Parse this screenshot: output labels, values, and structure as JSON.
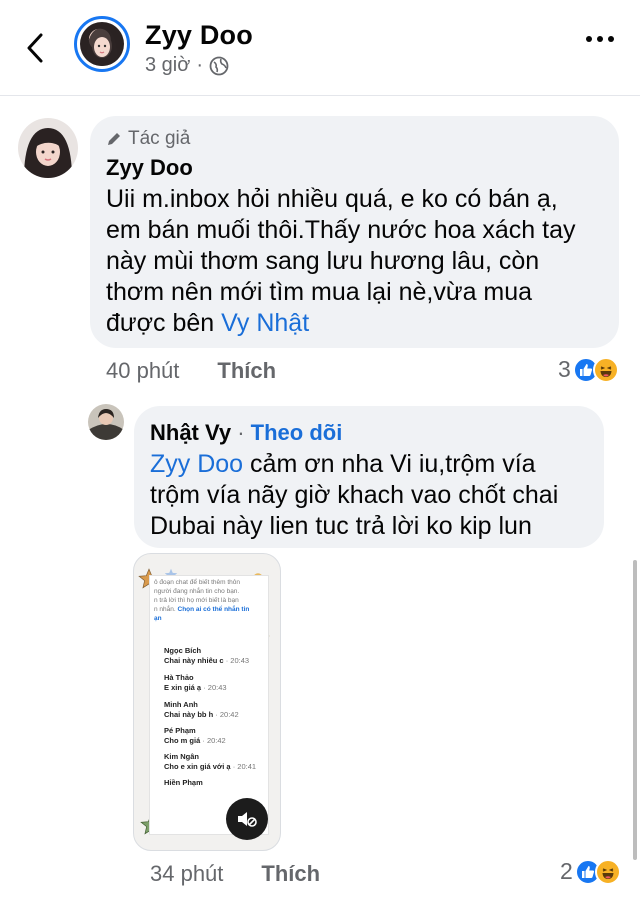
{
  "header": {
    "title": "Zyy Doo",
    "time": "3 giờ",
    "separator": "·"
  },
  "comment1": {
    "author_tag": "Tác giả",
    "name": "Zyy Doo",
    "text_lines": [
      "Uii m.inbox hỏi nhiều quá, e ko có bán ạ,",
      "em bán muối thôi.Thấy nước hoa xách tay",
      "này mùi thơm sang lưu hương lâu, còn",
      "thơm nên mới tìm mua lại nè,vừa mua"
    ],
    "last_line_prefix": "được bên ",
    "mention": "Vy Nhật",
    "time": "40 phút",
    "like_label": "Thích",
    "reaction_count": "3"
  },
  "reply1": {
    "name": "Nhật Vy",
    "separator": "·",
    "follow_label": "Theo dõi",
    "mention": "Zyy Doo",
    "text_first": " cảm ơn nha Vi iu,trộm vía",
    "text_lines": [
      "trộm vía nãy giờ khach vao chốt chai",
      "Dubai này lien tuc trả lời ko kip lun"
    ],
    "time": "34 phút",
    "like_label": "Thích",
    "reaction_count": "2"
  },
  "attachment": {
    "header_lines": [
      "ô đoạn chat để biết thêm thôn",
      "người đang nhắn tin cho bạn.",
      "n trả lời thì họ mới biết là bạn",
      "n nhắn."
    ],
    "header_link": "Chọn ai có thể nhắn tin",
    "header_link_tail": "ạn",
    "chats": [
      {
        "name": "Ngọc Bích",
        "msg": "Chai này nhiêu c",
        "time": "· 20:43"
      },
      {
        "name": "Hà Thảo",
        "msg": "E xin giá ạ",
        "time": "· 20:43"
      },
      {
        "name": "Minh Anh",
        "msg": "Chai này bb h",
        "time": "· 20:42"
      },
      {
        "name": "Pé Phạm",
        "msg": "Cho m giá",
        "time": "· 20:42"
      },
      {
        "name": "Kim Ngân",
        "msg": "Cho e xin giá với ạ",
        "time": "· 20:41"
      },
      {
        "name": "Hiền Phạm",
        "msg": "",
        "time": ""
      }
    ]
  },
  "icons": {
    "back": "back-arrow-icon",
    "globe": "globe-icon",
    "more": "more-icon",
    "pencil": "pencil-icon",
    "like": "like-reaction-icon",
    "haha": "haha-reaction-icon",
    "sound": "sound-off-icon"
  },
  "colors": {
    "accent": "#1877f2",
    "bubble": "#f0f2f5",
    "secondary_text": "#65676b"
  }
}
